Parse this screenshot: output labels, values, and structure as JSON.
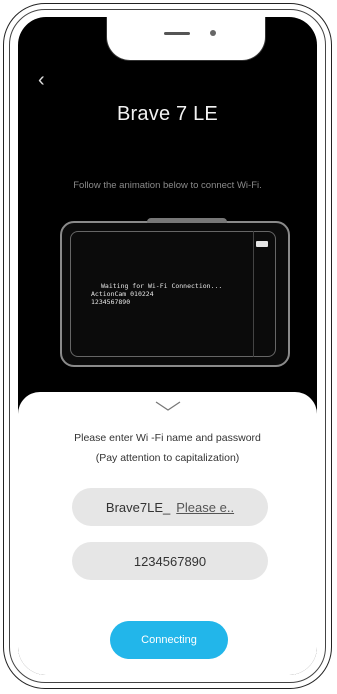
{
  "header": {
    "back_icon": "chevron-left-icon",
    "back_glyph": "‹",
    "title": "Brave 7 LE"
  },
  "instruction": "Follow the animation below to connect Wi-Fi.",
  "device_illustration": {
    "line1": "Waiting for Wi-Fi Connection...",
    "line2": "ActionCam 010224",
    "line3": "1234567890"
  },
  "sheet": {
    "collapse_icon": "chevron-down-icon",
    "prompt_line1": "Please enter Wi -Fi name and  password",
    "prompt_line2": "(Pay attention to capitalization)",
    "ssid_value": "Brave7LE_",
    "ssid_placeholder": "Please e..",
    "password_value": "1234567890",
    "connect_label": "Connecting"
  },
  "colors": {
    "accent": "#22b6ea",
    "screen_bg": "#000000",
    "field_bg": "#e6e6e6"
  }
}
